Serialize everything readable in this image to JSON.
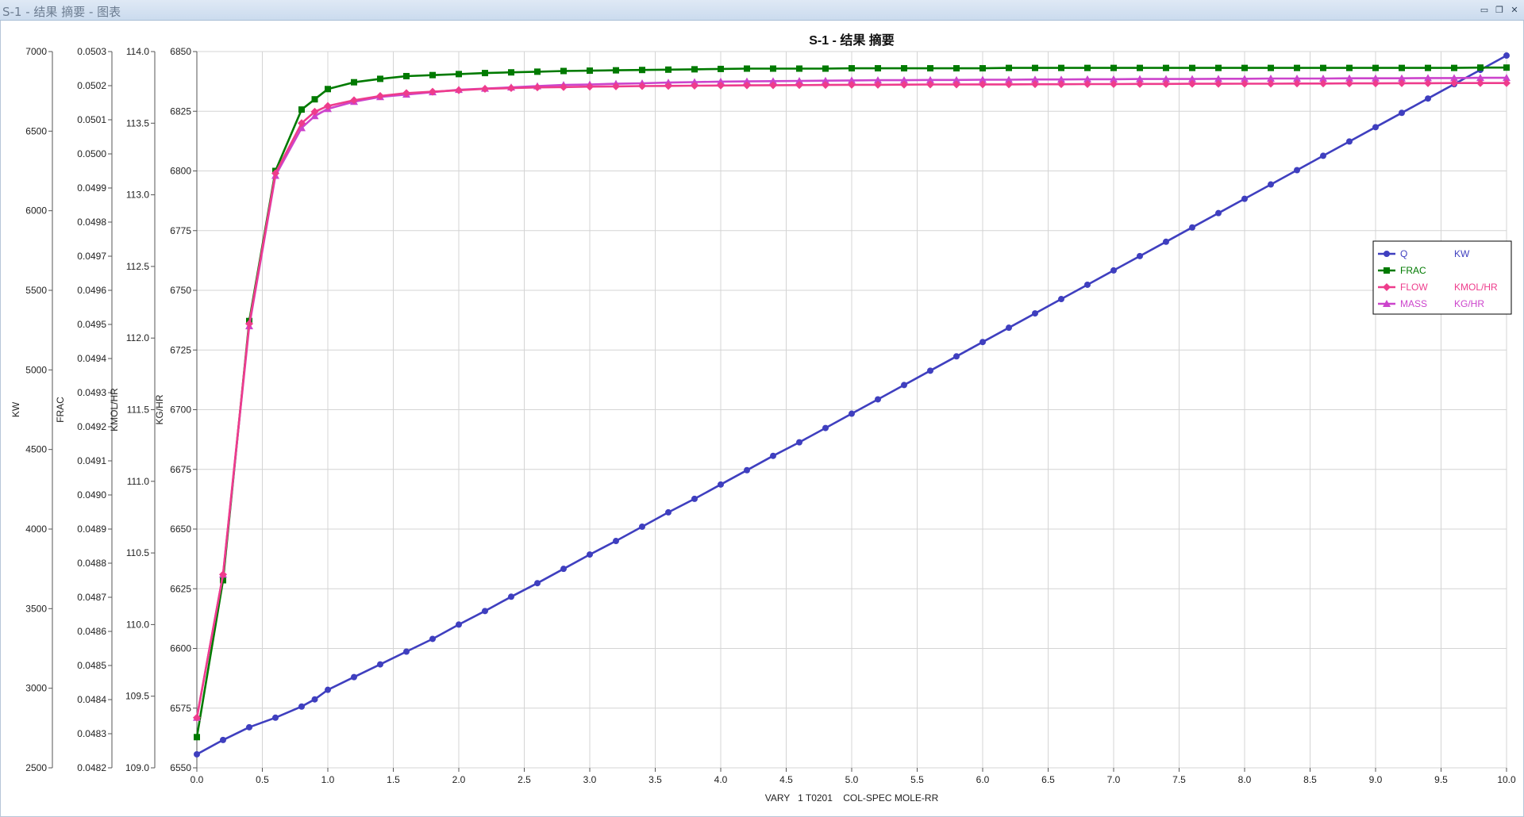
{
  "window": {
    "title": "S-1 - 结果 摘要 - 图表",
    "buttons": {
      "minimize": "▭",
      "restore": "❐",
      "close": "✕"
    }
  },
  "chart_data": {
    "type": "line",
    "title": "S-1 - 结果 摘要",
    "xlabel": "VARY   1 T0201    COL-SPEC MOLE-RR",
    "xlim": [
      0,
      10
    ],
    "xticks": [
      "0.0",
      "0.5",
      "1.0",
      "1.5",
      "2.0",
      "2.5",
      "3.0",
      "3.5",
      "4.0",
      "4.5",
      "5.0",
      "5.5",
      "6.0",
      "6.5",
      "7.0",
      "7.5",
      "8.0",
      "8.5",
      "9.0",
      "9.5",
      "10.0"
    ],
    "grid": true,
    "legend_position": "right",
    "axes": [
      {
        "id": "kw",
        "label": "KW",
        "ylim": [
          2500,
          7000
        ],
        "ticks": [
          "2500",
          "3000",
          "3500",
          "4000",
          "4500",
          "5000",
          "5500",
          "6000",
          "6500",
          "7000"
        ]
      },
      {
        "id": "frac",
        "label": "FRAC",
        "ylim": [
          0.0482,
          0.0503
        ],
        "ticks": [
          "0.0482",
          "0.0483",
          "0.0484",
          "0.0485",
          "0.0486",
          "0.0487",
          "0.0488",
          "0.0489",
          "0.0490",
          "0.0491",
          "0.0492",
          "0.0493",
          "0.0494",
          "0.0495",
          "0.0496",
          "0.0497",
          "0.0498",
          "0.0499",
          "0.0500",
          "0.0501",
          "0.0502",
          "0.0503"
        ]
      },
      {
        "id": "kmol",
        "label": "KMOL/HR",
        "ylim": [
          109.0,
          114.0
        ],
        "ticks": [
          "109.0",
          "109.5",
          "110.0",
          "110.5",
          "111.0",
          "111.5",
          "112.0",
          "112.5",
          "113.0",
          "113.5",
          "114.0"
        ]
      },
      {
        "id": "kg",
        "label": "KG/HR",
        "ylim": [
          6550,
          6850
        ],
        "ticks": [
          "6550",
          "6575",
          "6600",
          "6625",
          "6650",
          "6675",
          "6700",
          "6725",
          "6750",
          "6775",
          "6800",
          "6825",
          "6850"
        ]
      }
    ],
    "series": [
      {
        "name": "Q",
        "unit": "KW",
        "axis": "kw",
        "color": "#3f3fbf",
        "marker": "circle",
        "x": [
          0.0,
          0.2,
          0.4,
          0.6,
          0.8,
          0.9,
          1.0,
          1.2,
          1.4,
          1.6,
          1.8,
          2.0,
          2.2,
          2.4,
          2.6,
          2.8,
          3.0,
          3.2,
          3.4,
          3.6,
          3.8,
          4.0,
          4.2,
          4.4,
          4.6,
          4.8,
          5.0,
          5.2,
          5.4,
          5.6,
          5.8,
          6.0,
          6.2,
          6.4,
          6.6,
          6.8,
          7.0,
          7.2,
          7.4,
          7.6,
          7.8,
          8.0,
          8.2,
          8.4,
          8.6,
          8.8,
          9.0,
          9.2,
          9.4,
          9.6,
          9.8,
          10.0
        ],
        "y": [
          2585,
          2675,
          2755,
          2815,
          2885,
          2930,
          2990,
          3070,
          3150,
          3230,
          3310,
          3400,
          3485,
          3575,
          3660,
          3750,
          3840,
          3925,
          4015,
          4105,
          4190,
          4280,
          4370,
          4460,
          4545,
          4635,
          4725,
          4815,
          4905,
          4995,
          5085,
          5175,
          5265,
          5355,
          5445,
          5535,
          5625,
          5715,
          5805,
          5895,
          5985,
          6075,
          6165,
          6255,
          6345,
          6435,
          6525,
          6615,
          6705,
          6795,
          6885,
          6975
        ]
      },
      {
        "name": "FRAC",
        "unit": "",
        "axis": "frac",
        "color": "#007a00",
        "marker": "square",
        "x": [
          0.0,
          0.2,
          0.4,
          0.6,
          0.8,
          0.9,
          1.0,
          1.2,
          1.4,
          1.6,
          1.8,
          2.0,
          2.2,
          2.4,
          2.6,
          2.8,
          3.0,
          3.2,
          3.4,
          3.6,
          3.8,
          4.0,
          4.2,
          4.4,
          4.6,
          4.8,
          5.0,
          5.2,
          5.4,
          5.6,
          5.8,
          6.0,
          6.2,
          6.4,
          6.6,
          6.8,
          7.0,
          7.2,
          7.4,
          7.6,
          7.8,
          8.0,
          8.2,
          8.4,
          8.6,
          8.8,
          9.0,
          9.2,
          9.4,
          9.6,
          9.8,
          10.0
        ],
        "y": [
          0.04829,
          0.04875,
          0.04951,
          0.04995,
          0.05013,
          0.05016,
          0.05019,
          0.05021,
          0.05022,
          0.050228,
          0.050231,
          0.050234,
          0.050237,
          0.050239,
          0.050241,
          0.050243,
          0.050244,
          0.050245,
          0.050246,
          0.050247,
          0.050248,
          0.050249,
          0.05025,
          0.05025,
          0.05025,
          0.05025,
          0.050251,
          0.050251,
          0.050251,
          0.050251,
          0.050251,
          0.050251,
          0.050252,
          0.050252,
          0.050252,
          0.050252,
          0.050252,
          0.050252,
          0.050252,
          0.050252,
          0.050252,
          0.050252,
          0.050252,
          0.050252,
          0.050252,
          0.050252,
          0.050252,
          0.050252,
          0.050252,
          0.050252,
          0.050253,
          0.050253
        ]
      },
      {
        "name": "FLOW",
        "unit": "KMOL/HR",
        "axis": "kmol",
        "color": "#ee3c8c",
        "marker": "diamond",
        "x": [
          0.0,
          0.2,
          0.4,
          0.6,
          0.8,
          0.9,
          1.0,
          1.2,
          1.4,
          1.6,
          1.8,
          2.0,
          2.2,
          2.4,
          2.6,
          2.8,
          3.0,
          3.2,
          3.4,
          3.6,
          3.8,
          4.0,
          4.2,
          4.4,
          4.6,
          4.8,
          5.0,
          5.2,
          5.4,
          5.6,
          5.8,
          6.0,
          6.2,
          6.4,
          6.6,
          6.8,
          7.0,
          7.2,
          7.4,
          7.6,
          7.8,
          8.0,
          8.2,
          8.4,
          8.6,
          8.8,
          9.0,
          9.2,
          9.4,
          9.6,
          9.8,
          10.0
        ],
        "y": [
          109.35,
          110.35,
          112.1,
          113.15,
          113.5,
          113.58,
          113.62,
          113.66,
          113.69,
          113.71,
          113.72,
          113.73,
          113.74,
          113.745,
          113.75,
          113.752,
          113.755,
          113.757,
          113.759,
          113.76,
          113.762,
          113.763,
          113.764,
          113.765,
          113.766,
          113.767,
          113.768,
          113.768,
          113.769,
          113.77,
          113.77,
          113.771,
          113.771,
          113.772,
          113.772,
          113.773,
          113.773,
          113.774,
          113.774,
          113.775,
          113.775,
          113.776,
          113.776,
          113.777,
          113.777,
          113.778,
          113.778,
          113.779,
          113.779,
          113.78,
          113.78,
          113.78
        ]
      },
      {
        "name": "MASS",
        "unit": "KG/HR",
        "axis": "kg",
        "color": "#cc44cc",
        "marker": "triangle",
        "x": [
          0.0,
          0.2,
          0.4,
          0.6,
          0.8,
          0.9,
          1.0,
          1.2,
          1.4,
          1.6,
          1.8,
          2.0,
          2.2,
          2.4,
          2.6,
          2.8,
          3.0,
          3.2,
          3.4,
          3.6,
          3.8,
          4.0,
          4.2,
          4.4,
          4.6,
          4.8,
          5.0,
          5.2,
          5.4,
          5.6,
          5.8,
          6.0,
          6.2,
          6.4,
          6.6,
          6.8,
          7.0,
          7.2,
          7.4,
          7.6,
          7.8,
          8.0,
          8.2,
          8.4,
          8.6,
          8.8,
          9.0,
          9.2,
          9.4,
          9.6,
          9.8,
          10.0
        ],
        "y": [
          6571,
          6631,
          6735,
          6798,
          6818,
          6823,
          6826,
          6829,
          6831,
          6832,
          6833,
          6834,
          6834.5,
          6835,
          6835.5,
          6836,
          6836.2,
          6836.5,
          6836.7,
          6837,
          6837.2,
          6837.4,
          6837.5,
          6837.6,
          6837.7,
          6837.8,
          6837.9,
          6838,
          6838,
          6838.1,
          6838.1,
          6838.2,
          6838.2,
          6838.3,
          6838.3,
          6838.4,
          6838.4,
          6838.5,
          6838.5,
          6838.5,
          6838.6,
          6838.6,
          6838.7,
          6838.7,
          6838.7,
          6838.8,
          6838.8,
          6838.8,
          6838.9,
          6838.9,
          6839,
          6839
        ]
      }
    ]
  }
}
